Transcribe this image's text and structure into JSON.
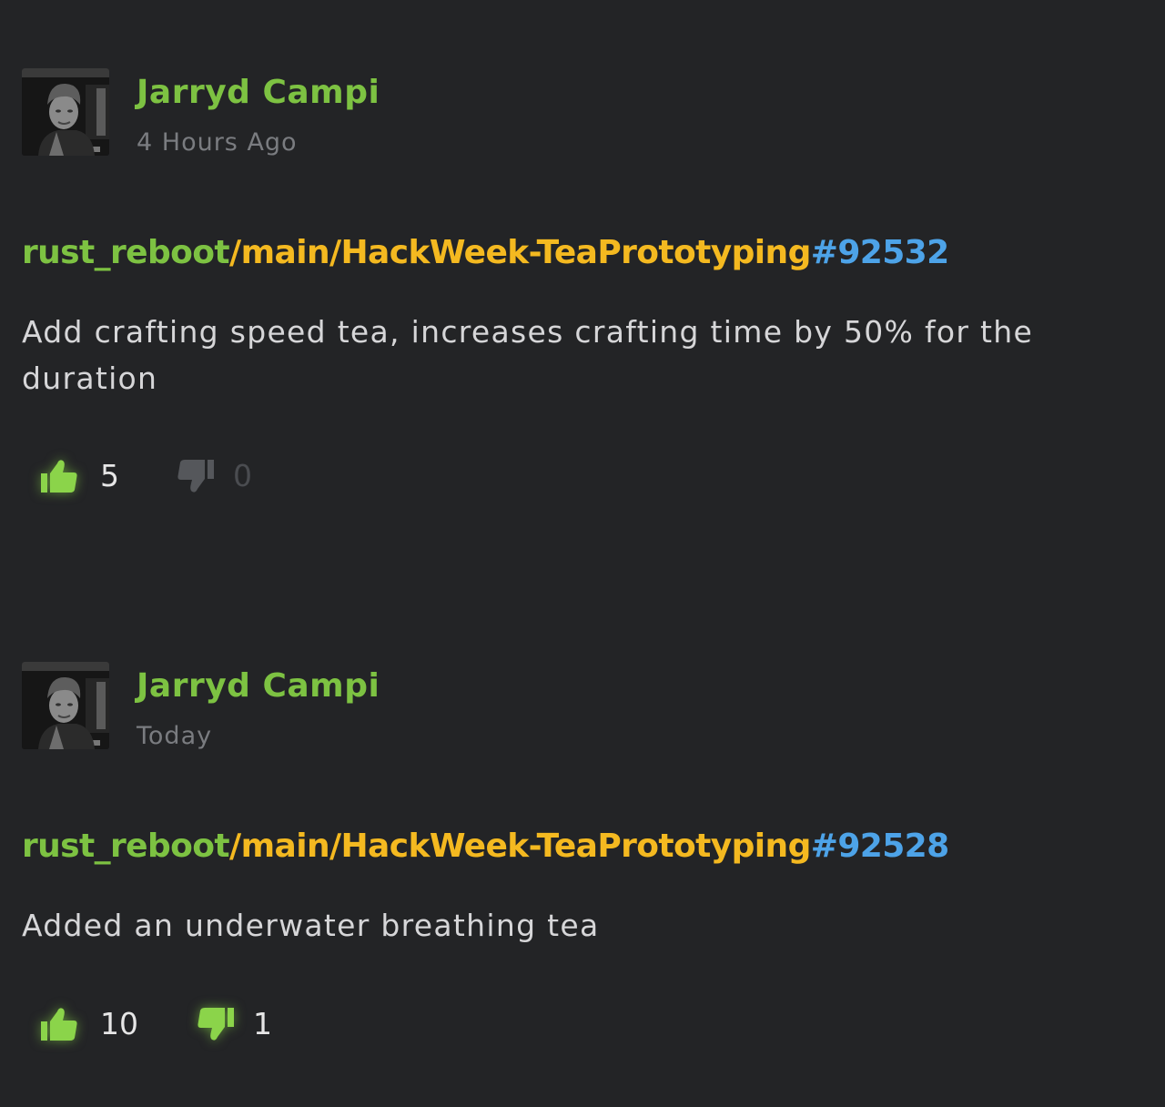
{
  "commits": [
    {
      "author": "Jarryd Campi",
      "time": "4 Hours Ago",
      "repo": "rust_reboot",
      "branch": "/main/HackWeek-TeaPrototyping",
      "changeset": "#92532",
      "message": "Add crafting speed tea, increases crafting time by 50% for the duration",
      "likes": "5",
      "dislikes": "0"
    },
    {
      "author": "Jarryd Campi",
      "time": "Today",
      "repo": "rust_reboot",
      "branch": "/main/HackWeek-TeaPrototyping",
      "changeset": "#92528",
      "message": "Added an underwater breathing tea",
      "likes": "10",
      "dislikes": "1"
    }
  ],
  "icons": {
    "like": "thumbs-up-icon",
    "dislike": "thumbs-down-icon"
  },
  "colors": {
    "author": "#7dc242",
    "repo": "#7dc242",
    "branch": "#f4b920",
    "changeset": "#4da3e8",
    "vote_active": "#8bd44a"
  }
}
